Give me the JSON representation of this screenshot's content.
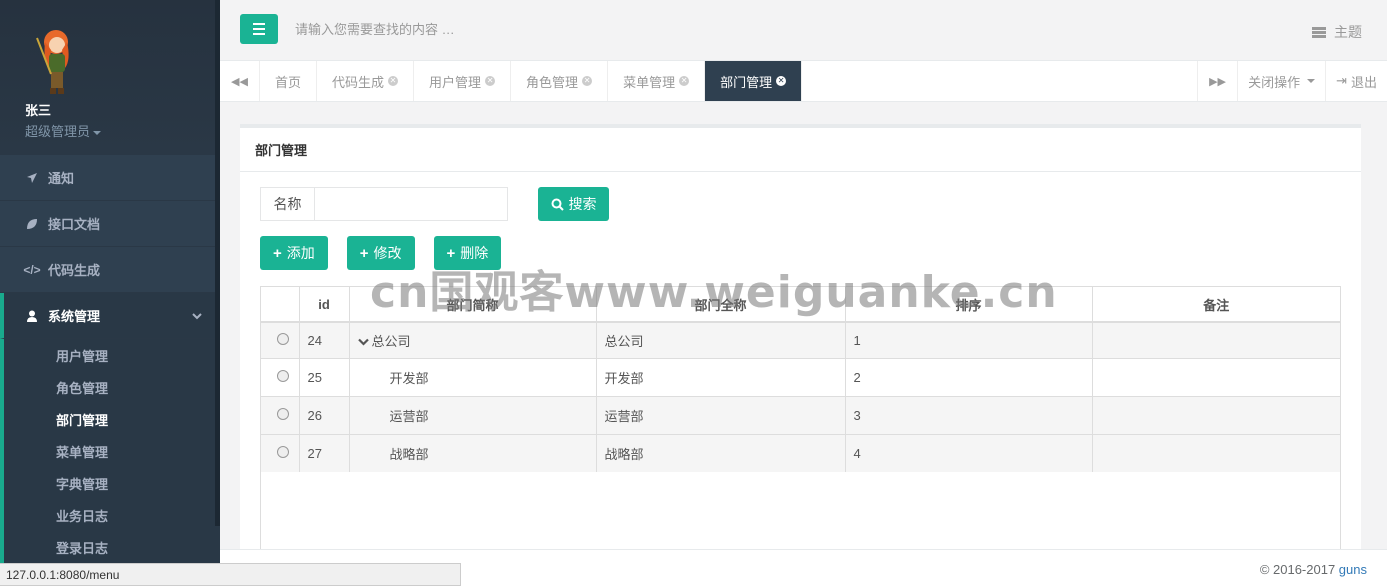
{
  "user": {
    "name": "张三",
    "role": "超级管理员"
  },
  "sidebar": {
    "items": [
      {
        "label": "通知",
        "icon": "paper-plane-icon"
      },
      {
        "label": "接口文档",
        "icon": "leaf-icon"
      },
      {
        "label": "代码生成",
        "icon": "code-icon"
      },
      {
        "label": "系统管理",
        "icon": "user-icon"
      }
    ],
    "sub_items": [
      "用户管理",
      "角色管理",
      "部门管理",
      "菜单管理",
      "字典管理",
      "业务日志",
      "登录日志"
    ],
    "current_sub": "部门管理"
  },
  "topbar": {
    "search_placeholder": "请输入您需要查找的内容 …",
    "theme_label": "主题"
  },
  "tabs": [
    "首页",
    "代码生成",
    "用户管理",
    "角色管理",
    "菜单管理",
    "部门管理"
  ],
  "tabs_right": {
    "close_ops": "关闭操作",
    "logout": "退出"
  },
  "panel": {
    "title": "部门管理",
    "search_label": "名称",
    "search_value": "",
    "search_button": "搜索",
    "buttons": {
      "add": "添加",
      "edit": "修改",
      "delete": "删除"
    }
  },
  "table": {
    "headers": [
      "id",
      "部门简称",
      "部门全称",
      "排序",
      "备注"
    ],
    "rows": [
      {
        "id": "24",
        "simple": "总公司",
        "full": "总公司",
        "order": "1",
        "note": ""
      },
      {
        "id": "25",
        "simple": "开发部",
        "full": "开发部",
        "order": "2",
        "note": ""
      },
      {
        "id": "26",
        "simple": "运营部",
        "full": "运营部",
        "order": "3",
        "note": ""
      },
      {
        "id": "27",
        "simple": "战略部",
        "full": "战略部",
        "order": "4",
        "note": ""
      }
    ]
  },
  "watermark": "cn国观客www.weiguanke.cn",
  "footer": {
    "copyright": "© 2016-2017",
    "brand": "guns"
  },
  "statusbar": {
    "url": "127.0.0.1:8080/menu"
  },
  "colors": {
    "accent": "#1ab394",
    "sidebar": "#2f4050",
    "active_tab": "#2f4050"
  }
}
